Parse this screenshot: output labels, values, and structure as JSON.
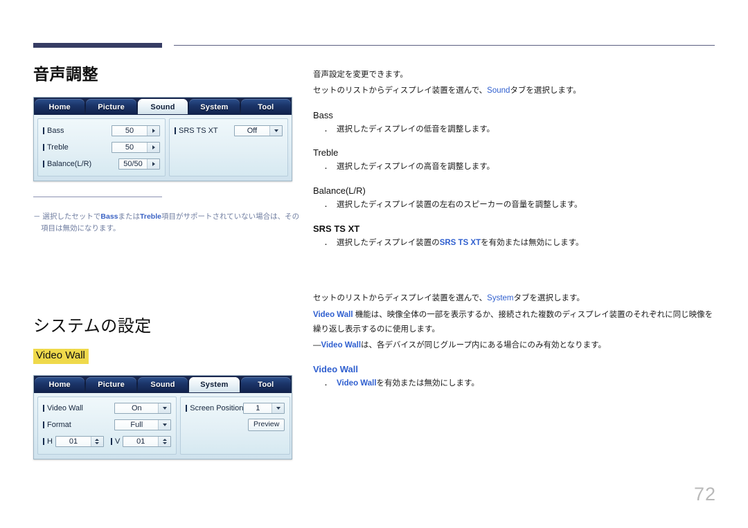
{
  "page": {
    "number": "72"
  },
  "sound_section": {
    "title": "音声調整",
    "osd": {
      "tabs": [
        {
          "label": "Home",
          "active": false
        },
        {
          "label": "Picture",
          "active": false
        },
        {
          "label": "Sound",
          "active": true
        },
        {
          "label": "System",
          "active": false
        },
        {
          "label": "Tool",
          "active": false
        }
      ],
      "left_rows": [
        {
          "label": "Bass",
          "value": "50",
          "control": "arrow"
        },
        {
          "label": "Treble",
          "value": "50",
          "control": "arrow"
        },
        {
          "label": "Balance(L/R)",
          "value": "50/50",
          "control": "arrow"
        }
      ],
      "right_rows": [
        {
          "label": "SRS TS XT",
          "value": "Off",
          "control": "dropdown"
        }
      ]
    },
    "note": {
      "prefix": "－",
      "text_1": "選択したセットで",
      "bold_1": "Bass",
      "text_2": "または",
      "bold_2": "Treble",
      "text_3": "項目がサポートされていない場合は、その項目は無効になります。"
    },
    "intro_line_1": "音声設定を変更できます。",
    "intro_line_2_a": "セットのリストからディスプレイ装置を選んで、",
    "intro_line_2_link": "Sound",
    "intro_line_2_b": "タブを選択します。",
    "items": [
      {
        "heading": "Bass",
        "heading_style": "plain",
        "bullet_a": "選択したディスプレイの低音を調整します。",
        "bullet_link": "",
        "bullet_b": ""
      },
      {
        "heading": "Treble",
        "heading_style": "plain",
        "bullet_a": "選択したディスプレイの高音を調整します。",
        "bullet_link": "",
        "bullet_b": ""
      },
      {
        "heading": "Balance(L/R)",
        "heading_style": "plain",
        "bullet_a": "選択したディスプレイ装置の左右のスピーカーの音量を調整します。",
        "bullet_link": "",
        "bullet_b": ""
      },
      {
        "heading": "SRS TS XT",
        "heading_style": "bold",
        "bullet_a": "選択したディスプレイ装置の",
        "bullet_link": "SRS TS XT",
        "bullet_b": "を有効または無効にします。"
      }
    ]
  },
  "system_section": {
    "title": "システムの設定",
    "highlight_heading": "Video Wall",
    "osd": {
      "tabs": [
        {
          "label": "Home",
          "active": false
        },
        {
          "label": "Picture",
          "active": false
        },
        {
          "label": "Sound",
          "active": false
        },
        {
          "label": "System",
          "active": true
        },
        {
          "label": "Tool",
          "active": false
        }
      ],
      "left_rows": [
        {
          "label": "Video Wall",
          "value": "On",
          "control": "dropdown"
        },
        {
          "label": "Format",
          "value": "Full",
          "control": "dropdown"
        }
      ],
      "steppers": [
        {
          "label": "H",
          "value": "01"
        },
        {
          "label": "V",
          "value": "01"
        }
      ],
      "right_rows": [
        {
          "label": "Screen Position",
          "value": "1",
          "control": "dropdown"
        }
      ],
      "preview_button": "Preview"
    },
    "intro_line_1_a": "セットのリストからディスプレイ装置を選んで、",
    "intro_line_1_link": "System",
    "intro_line_1_b": "タブを選択します。",
    "intro_line_2_link": "Video Wall",
    "intro_line_2_text": " 機能は、映像全体の一部を表示するか、接続された複数のディスプレイ装置のそれぞれに同じ映像を繰り返し表示するのに使用します。",
    "dash_note_prefix": "―",
    "dash_note_link": "Video Wall",
    "dash_note_text": "は、各デバイスが同じグループ内にある場合にのみ有効となります。",
    "items": [
      {
        "heading": "Video Wall",
        "bullet_link": "Video Wall",
        "bullet_text": "を有効または無効にします。"
      }
    ]
  }
}
